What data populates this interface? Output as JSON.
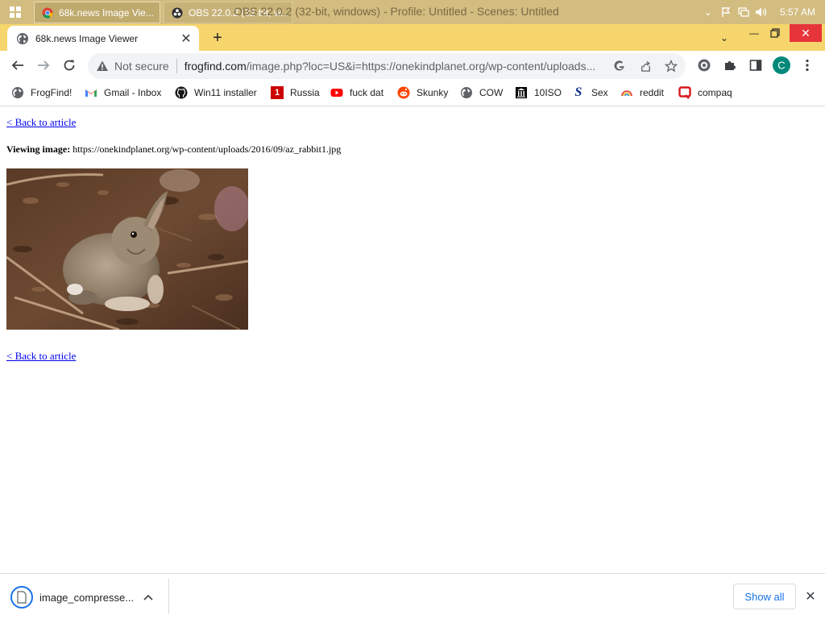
{
  "taskbar": {
    "tasks": [
      {
        "label": "68k.news Image Vie...",
        "icon": "chrome-icon"
      },
      {
        "label": "OBS 22.0.2 (32-bit, w...",
        "icon": "obs-icon"
      }
    ],
    "obs_title": "OBS 22.0.2 (32-bit, windows) - Profile: Untitled - Scenes: Untitled",
    "clock": "5:57 AM",
    "tray_icons": [
      "chevron-up-icon",
      "flag-icon",
      "network-icon",
      "volume-icon"
    ]
  },
  "browser": {
    "tab": {
      "title": "68k.news Image Viewer",
      "icon": "globe-icon"
    },
    "omnibox": {
      "security_text": "Not secure",
      "url_host": "frogfind.com",
      "url_rest": "/image.php?loc=US&i=https://onekindplanet.org/wp-content/uploads..."
    },
    "bookmarks": [
      {
        "label": "FrogFind!",
        "icon": "globe-icon"
      },
      {
        "label": "Gmail - Inbox",
        "icon": "gmail-icon"
      },
      {
        "label": "Win11 installer",
        "icon": "github-icon"
      },
      {
        "label": "Russia",
        "icon": "red-square-icon"
      },
      {
        "label": "fuck dat",
        "icon": "youtube-icon"
      },
      {
        "label": "Skunky",
        "icon": "reddit-icon"
      },
      {
        "label": "COW",
        "icon": "globe-icon"
      },
      {
        "label": "10ISO",
        "icon": "building-icon"
      },
      {
        "label": "Sex",
        "icon": "s-logo-icon"
      },
      {
        "label": "reddit",
        "icon": "rainbow-icon"
      },
      {
        "label": "compaq",
        "icon": "q-logo-icon"
      }
    ],
    "profile_initial": "C"
  },
  "page": {
    "back_link": "< Back to article",
    "viewing_label": "Viewing image:",
    "viewing_url": "https://onekindplanet.org/wp-content/uploads/2016/09/az_rabbit1.jpg"
  },
  "downloads": {
    "item_name": "image_compresse...",
    "show_all": "Show all"
  },
  "colors": {
    "tab_strip": "#f6d66c",
    "taskbar": "#d3bc80",
    "link": "#0000ee",
    "accent": "#1a73e8",
    "profile": "#00897b",
    "close_red": "#e7343b"
  }
}
